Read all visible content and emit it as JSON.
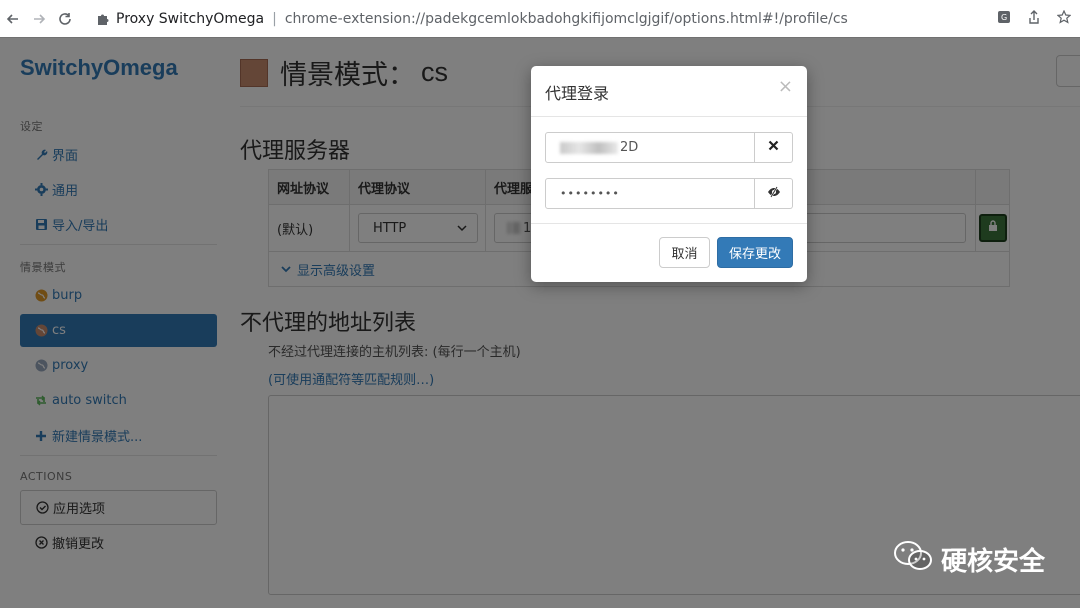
{
  "browser": {
    "tab_title": "Proxy SwitchyOmega",
    "separator": "|",
    "url": "chrome-extension://padekgcemlokbadohgkifijomclgjgif/options.html#!/profile/cs"
  },
  "sidebar": {
    "brand": "SwitchyOmega",
    "settings_header": "设定",
    "settings_items": [
      {
        "label": "界面",
        "icon": "wrench-icon"
      },
      {
        "label": "通用",
        "icon": "gear-icon"
      },
      {
        "label": "导入/导出",
        "icon": "floppy-icon"
      }
    ],
    "profiles_header": "情景模式",
    "profiles": [
      {
        "label": "burp",
        "icon": "globe-icon",
        "color": "#e09a2a"
      },
      {
        "label": "cs",
        "icon": "globe-icon",
        "color": "#c98d6f",
        "active": true
      },
      {
        "label": "proxy",
        "icon": "globe-icon",
        "color": "#99a9bf"
      },
      {
        "label": "auto switch",
        "icon": "retweet-icon",
        "color": "#5cb85c"
      },
      {
        "label": "新建情景模式...",
        "icon": "plus-icon"
      }
    ],
    "actions_header": "ACTIONS",
    "apply_label": "应用选项",
    "discard_label": "撤销更改"
  },
  "main": {
    "title_prefix": "情景模式：",
    "profile_name": "cs",
    "swatch_color": "#c98d6f",
    "proxy_section_title": "代理服务器",
    "table_headers": [
      "网址协议",
      "代理协议",
      "代理服"
    ],
    "row_scheme": "(默认)",
    "row_protocol": "HTTP",
    "row_server_prefix": "1",
    "advanced_link": "显示高级设置",
    "bypass_title": "不代理的地址列表",
    "bypass_help": "不经过代理连接的主机列表: (每行一个主机)",
    "bypass_wildcard_link": "(可使用通配符等匹配规则…)"
  },
  "modal": {
    "title": "代理登录",
    "close": "×",
    "username_suffix": "2D",
    "password_mask": "••••••••",
    "cancel_label": "取消",
    "save_label": "保存更改"
  },
  "watermark": {
    "text": "硬核安全"
  }
}
